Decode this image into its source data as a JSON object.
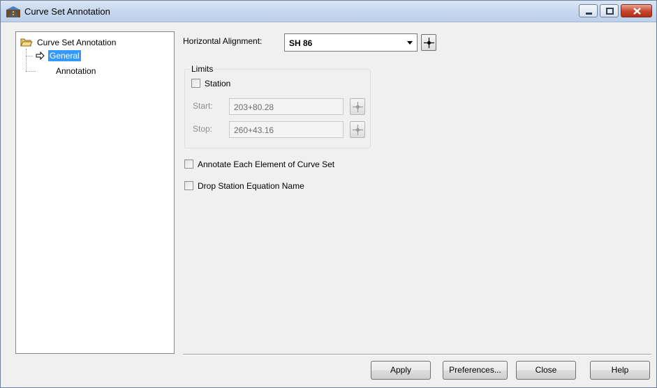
{
  "window": {
    "title": "Curve Set Annotation",
    "icon": "alignment-app-icon",
    "controls": [
      "minimize-icon",
      "maximize-icon",
      "close-icon"
    ]
  },
  "tree": {
    "root": {
      "label": "Curve Set Annotation",
      "icon": "open-folder-icon"
    },
    "items": [
      {
        "label": "General",
        "selected": true,
        "icon": "arrow-right-icon"
      },
      {
        "label": "Annotation",
        "selected": false
      }
    ]
  },
  "general": {
    "horizontal_alignment_label": "Horizontal Alignment:",
    "horizontal_alignment_value": "SH 86",
    "limits": {
      "title": "Limits",
      "station_label": "Station",
      "station_checked": false,
      "start_label": "Start:",
      "start_value": "203+80.28",
      "stop_label": "Stop:",
      "stop_value": "260+43.16"
    },
    "annotate_each_label": "Annotate Each Element of Curve Set",
    "annotate_each_checked": false,
    "drop_station_label": "Drop Station Equation Name",
    "drop_station_checked": false
  },
  "buttons": {
    "apply": "Apply",
    "preferences": "Preferences...",
    "close": "Close",
    "help": "Help"
  }
}
